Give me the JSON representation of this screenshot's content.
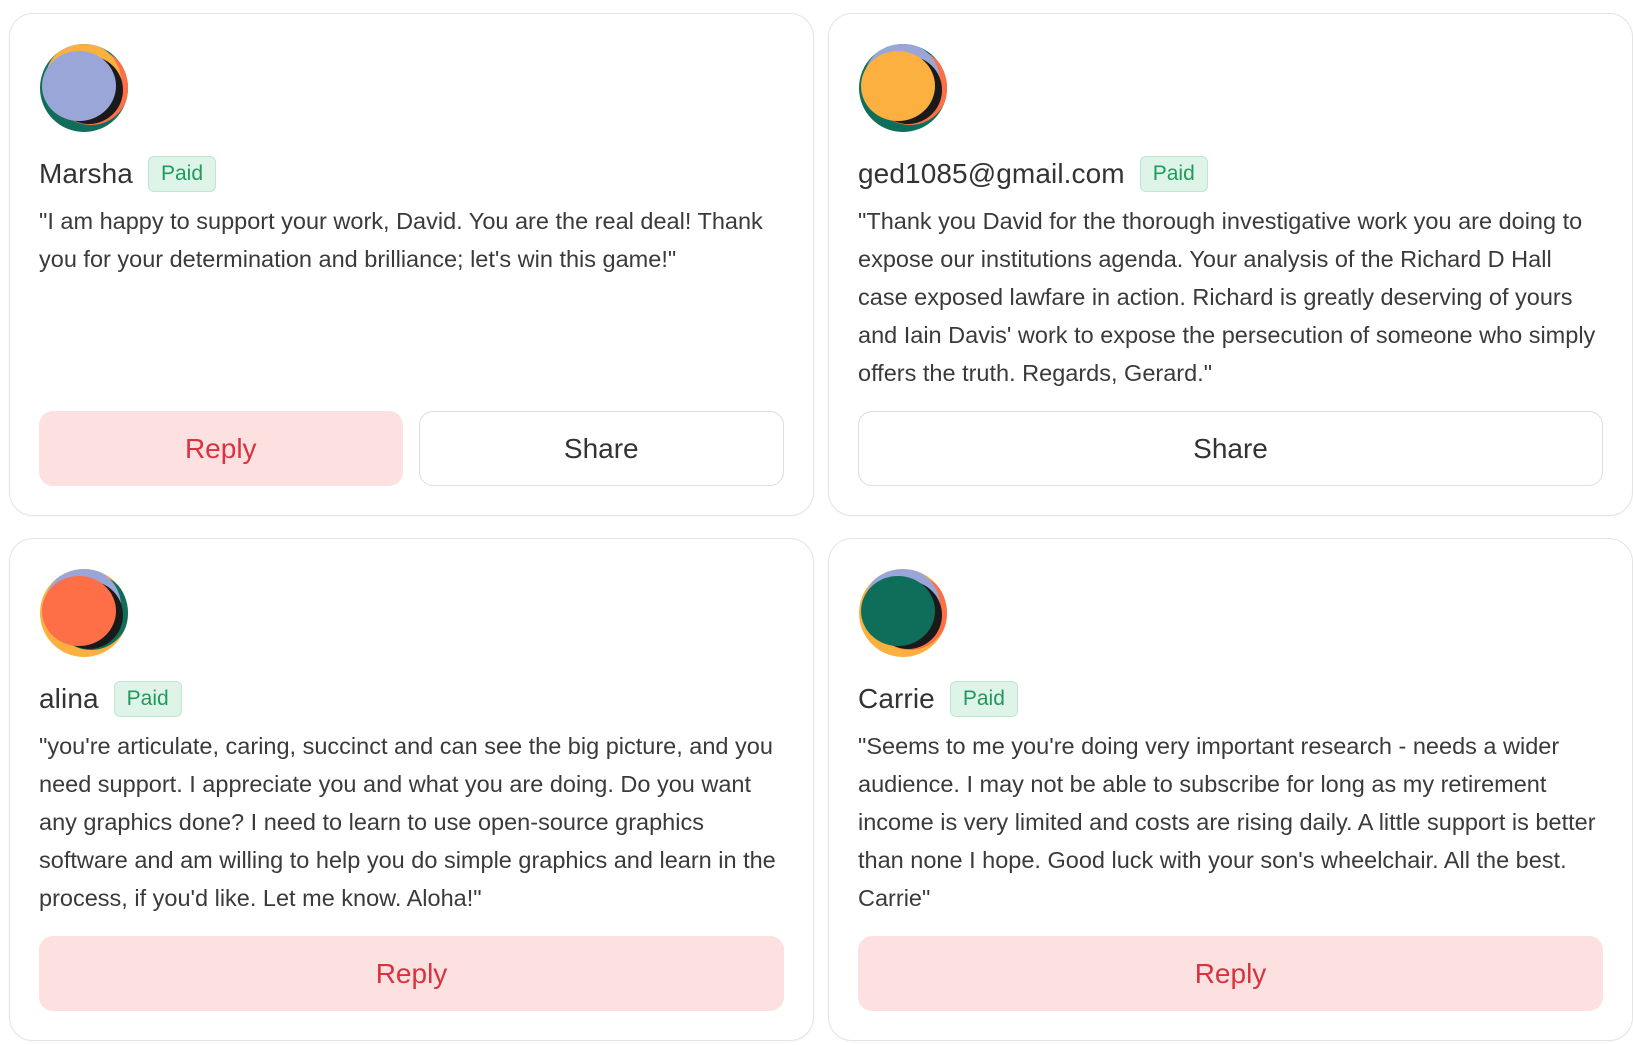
{
  "cards": [
    {
      "name": "Marsha",
      "badge": "Paid",
      "message": "\"I am happy to support your work, David. You are the real deal! Thank you for your determination and brilliance; let's win this game!\"",
      "reply_label": "Reply",
      "share_label": "Share",
      "avatar_color": "#9aa6d8"
    },
    {
      "name": "ged1085@gmail.com",
      "badge": "Paid",
      "message": "\"Thank you David for the thorough investigative work you are doing to expose our institutions agenda. Your analysis of the Richard D Hall case exposed lawfare in action. Richard is greatly deserving of yours and Iain Davis' work to expose the persecution of someone who simply offers the truth. Regards, Gerard.\"",
      "share_label": "Share",
      "avatar_color": "#fbb040"
    },
    {
      "name": "alina",
      "badge": "Paid",
      "message": "\"you're articulate, caring, succinct and can see the big picture, and you need support. I appreciate you and what you are doing. Do you want any graphics done? I need to learn to use open-source graphics software and am willing to help you do simple graphics and learn in the process, if you'd like. Let me know. Aloha!\"",
      "reply_label": "Reply",
      "avatar_color": "#ff6f47"
    },
    {
      "name": "Carrie",
      "badge": "Paid",
      "message": "\"Seems to me you're doing very important research - needs a wider audience. I may not be able to subscribe for long as my retirement income is very limited and costs are rising daily. A little support is better than none I hope. Good luck with your son's wheelchair. All the best. Carrie\"",
      "reply_label": "Reply",
      "avatar_color": "#0f6e5a"
    }
  ],
  "colors": {
    "badge_bg": "#dff4e9",
    "badge_text": "#1f9a5c",
    "reply_bg": "#fde0e0",
    "reply_text": "#d9333f",
    "avatar_orange": "#fbb040",
    "avatar_coral": "#ff6f47",
    "avatar_green": "#0f6e5a",
    "avatar_blue": "#9aa6d8"
  }
}
